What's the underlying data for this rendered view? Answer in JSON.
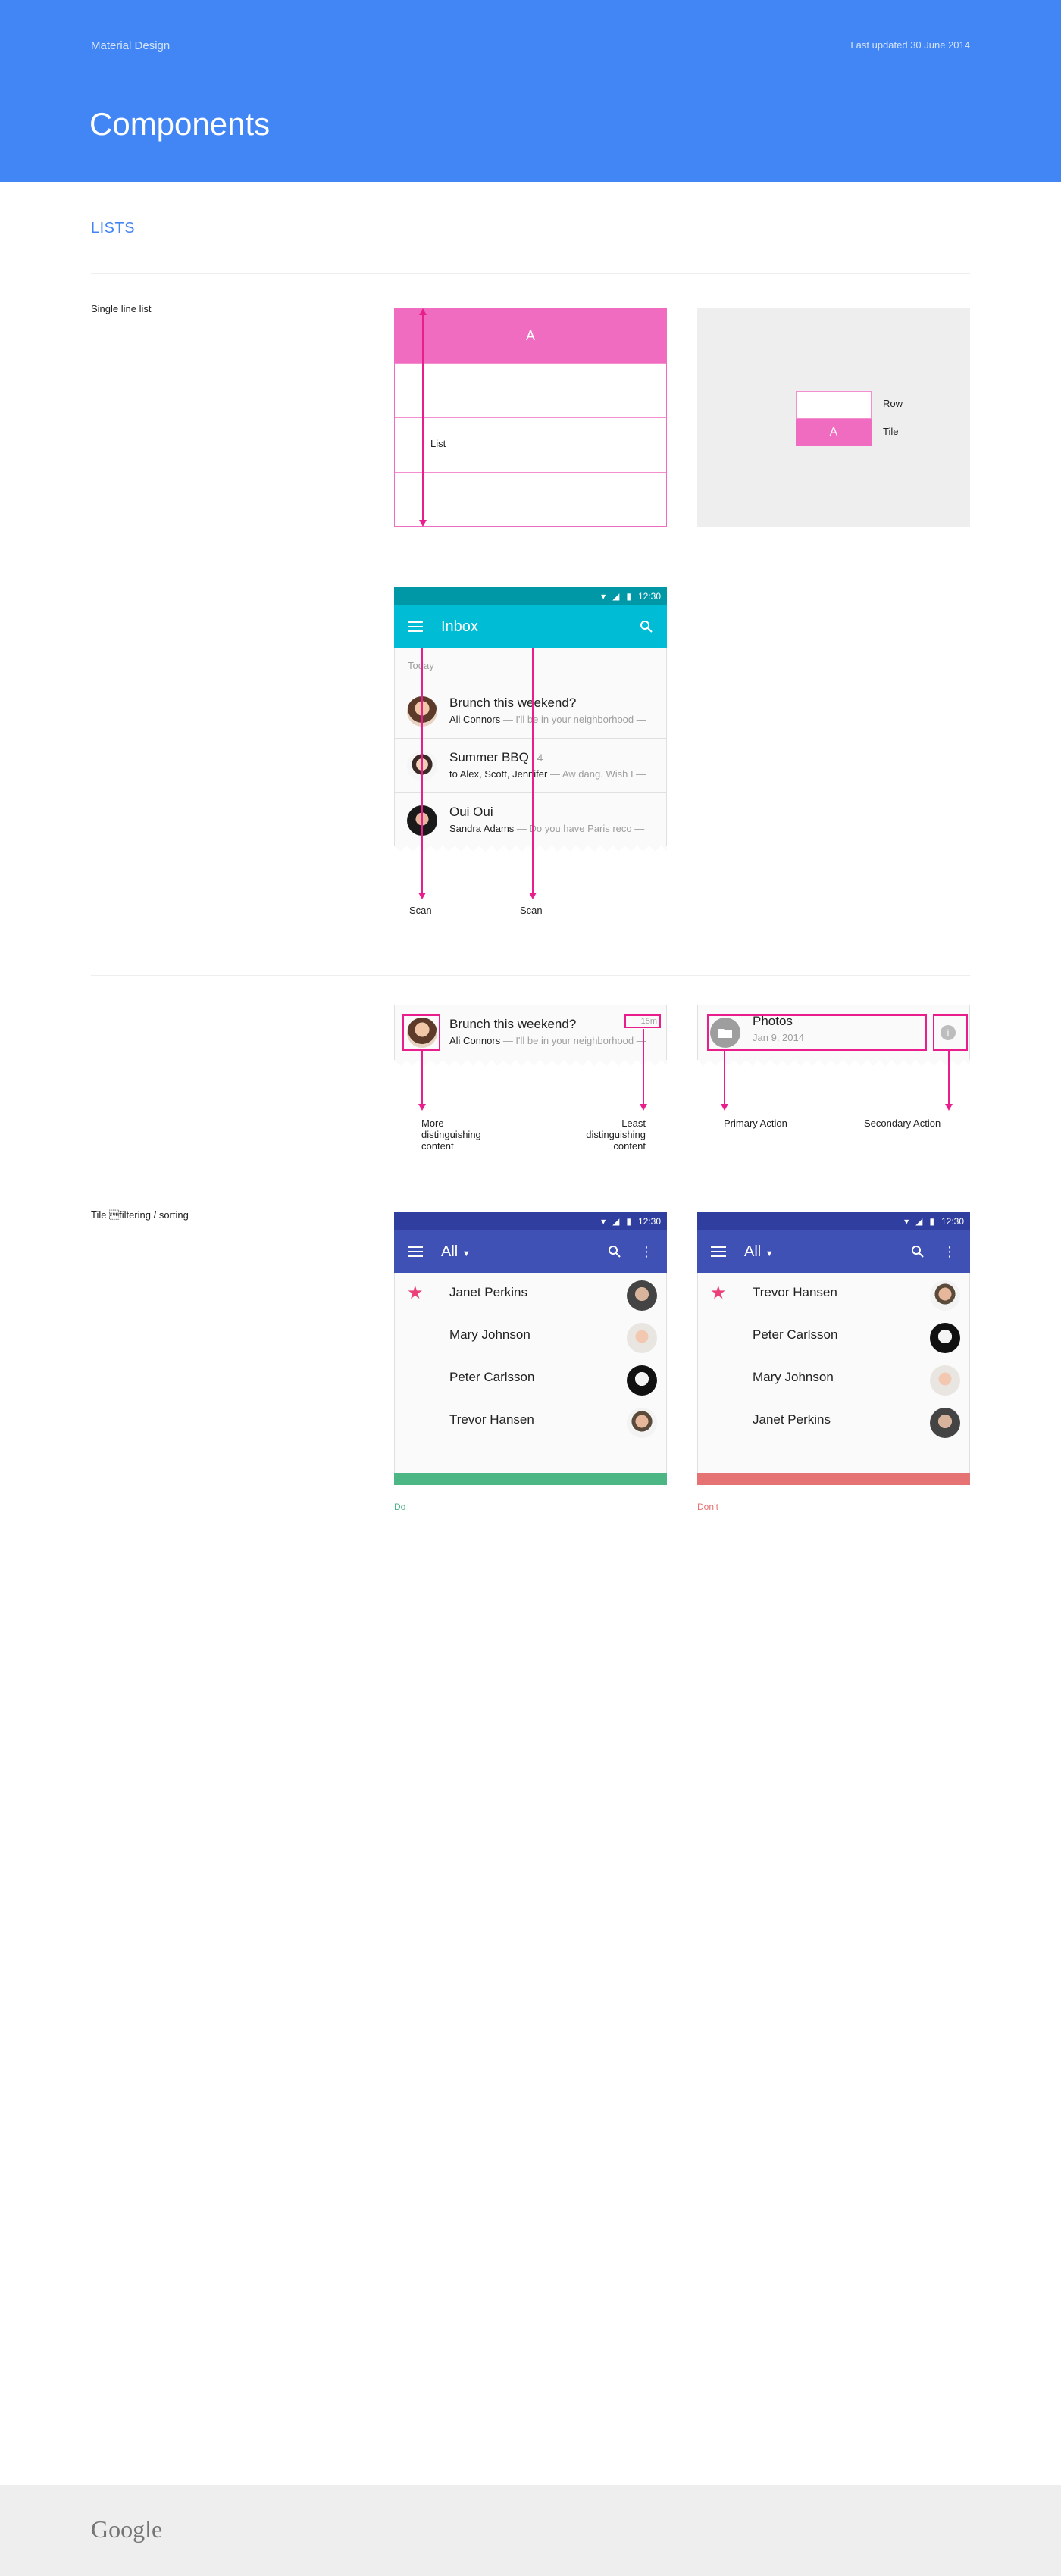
{
  "header": {
    "brand": "Material Design",
    "updated": "Last updated 30 June 2014",
    "title": "Components"
  },
  "section_title": "LISTS",
  "single_line": {
    "side_label": "Single line list",
    "tile_label": "A",
    "list_label": "List",
    "legend": {
      "row": "Row",
      "tile": "Tile",
      "tile_letter": "A"
    }
  },
  "inbox_phone": {
    "status_time": "12:30",
    "title": "Inbox",
    "today": "Today",
    "messages": [
      {
        "title": "Brunch this weekend?",
        "sender": "Ali Connors",
        "preview": " — I'll be in your neighborhood —"
      },
      {
        "title": "Summer BBQ",
        "count": "4",
        "sender": "to Alex, Scott, Jennifer",
        "preview": " — Aw dang. Wish I —"
      },
      {
        "title": "Oui Oui",
        "sender": "Sandra Adams",
        "preview": " — Do you have Paris reco —"
      }
    ],
    "scan_labels": [
      "Scan",
      "Scan"
    ]
  },
  "content_examples": {
    "message": {
      "title": "Brunch this weekend?",
      "sender": "Ali Connors",
      "preview": " — I'll be in your neighborhood —",
      "time": "15m"
    },
    "more_label": "More distinguishing content",
    "least_label": "Least distinguishing content",
    "photos": {
      "title": "Photos",
      "date": "Jan 9, 2014"
    },
    "primary_label": "Primary Action",
    "secondary_label": "Secondary Action"
  },
  "filtering": {
    "side_label": "Tile \u001afiltering / sorting",
    "status_time": "12:30",
    "title": "All",
    "do_list": [
      "Janet Perkins",
      "Mary Johnson",
      "Peter Carlsson",
      "Trevor Hansen"
    ],
    "dont_list": [
      "Trevor Hansen",
      "Peter Carlsson",
      "Mary Johnson",
      "Janet Perkins"
    ],
    "do_label": "Do",
    "dont_label": "Don’t"
  },
  "footer": {
    "logo": "Google"
  },
  "colors": {
    "header": "#4285f4",
    "tile_pink": "#f06cc0",
    "annotation": "#e91e8c",
    "inbox_status": "#0097a7",
    "inbox_appbar": "#00bcd4",
    "indigo_status": "#303f9f",
    "indigo_appbar": "#3f51b5",
    "do_green": "#4cb685",
    "dont_red": "#e57373"
  }
}
